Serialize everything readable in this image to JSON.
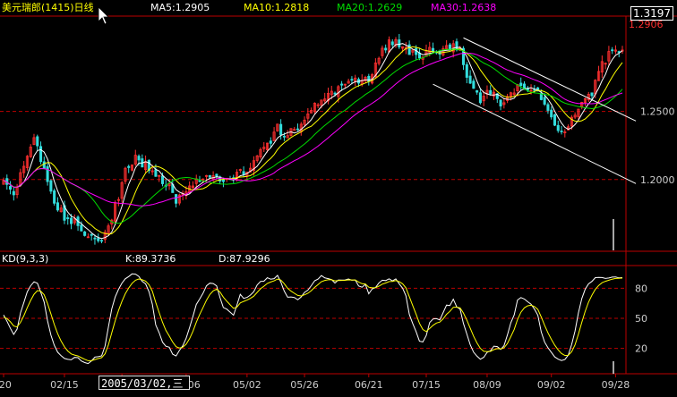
{
  "header": {
    "title": "美元瑞郎(1415)日线",
    "ma5": "MA5:1.2905",
    "ma10": "MA10:1.2818",
    "ma20": "MA20:1.2629",
    "ma30": "MA30:1.2638",
    "last_price": "1.3197",
    "price_tag": "1.2906"
  },
  "kd_header": {
    "label": "KD(9,3,3)",
    "k": "K:89.3736",
    "d": "D:87.9296"
  },
  "cursor_date": "2005/03/02,三",
  "colors": {
    "up": "#ff3030",
    "down": "#33dddd",
    "ma5": "#ffffff",
    "ma10": "#ffff00",
    "ma20": "#00dd00",
    "ma30": "#ff00ff",
    "grid": "#bb0000",
    "k": "#ffffff",
    "d": "#ffff00"
  },
  "chart_data": [
    {
      "type": "candlestick",
      "title": "美元瑞郎(1415)日线",
      "y_ticks": [
        "1.2000",
        "1.2500"
      ],
      "y_tick_values": [
        1.2,
        1.25
      ],
      "ylim": [
        1.148,
        1.32
      ],
      "x_tick_labels": [
        "/20",
        "02/15",
        "03/10",
        "04/06",
        "05/02",
        "05/26",
        "06/21",
        "07/15",
        "08/09",
        "09/02",
        "09/28"
      ],
      "x_tick_index": [
        0,
        18,
        35,
        54,
        72,
        89,
        108,
        125,
        143,
        162,
        181
      ],
      "anchors": [
        [
          0,
          1.196
        ],
        [
          3,
          1.19
        ],
        [
          6,
          1.21
        ],
        [
          9,
          1.228
        ],
        [
          12,
          1.21
        ],
        [
          15,
          1.185
        ],
        [
          18,
          1.172
        ],
        [
          21,
          1.168
        ],
        [
          24,
          1.16
        ],
        [
          27,
          1.155
        ],
        [
          30,
          1.158
        ],
        [
          33,
          1.18
        ],
        [
          36,
          1.205
        ],
        [
          39,
          1.215
        ],
        [
          42,
          1.21
        ],
        [
          45,
          1.205
        ],
        [
          48,
          1.198
        ],
        [
          51,
          1.185
        ],
        [
          54,
          1.19
        ],
        [
          57,
          1.202
        ],
        [
          60,
          1.2
        ],
        [
          63,
          1.2
        ],
        [
          66,
          1.198
        ],
        [
          69,
          1.205
        ],
        [
          72,
          1.208
        ],
        [
          75,
          1.218
        ],
        [
          78,
          1.225
        ],
        [
          81,
          1.238
        ],
        [
          84,
          1.233
        ],
        [
          87,
          1.24
        ],
        [
          90,
          1.25
        ],
        [
          93,
          1.258
        ],
        [
          96,
          1.262
        ],
        [
          99,
          1.265
        ],
        [
          102,
          1.27
        ],
        [
          105,
          1.272
        ],
        [
          108,
          1.275
        ],
        [
          111,
          1.29
        ],
        [
          114,
          1.302
        ],
        [
          117,
          1.3
        ],
        [
          120,
          1.295
        ],
        [
          123,
          1.29
        ],
        [
          126,
          1.298
        ],
        [
          129,
          1.292
        ],
        [
          132,
          1.298
        ],
        [
          135,
          1.295
        ],
        [
          138,
          1.27
        ],
        [
          141,
          1.258
        ],
        [
          144,
          1.265
        ],
        [
          147,
          1.255
        ],
        [
          150,
          1.262
        ],
        [
          153,
          1.27
        ],
        [
          156,
          1.268
        ],
        [
          159,
          1.262
        ],
        [
          162,
          1.245
        ],
        [
          165,
          1.232
        ],
        [
          168,
          1.245
        ],
        [
          171,
          1.258
        ],
        [
          174,
          1.265
        ],
        [
          177,
          1.285
        ],
        [
          180,
          1.294
        ],
        [
          182,
          1.296
        ]
      ],
      "channel_lines": [
        [
          [
            136,
            1.304
          ],
          [
            187,
            1.243
          ]
        ],
        [
          [
            127,
            1.27
          ],
          [
            187,
            1.197
          ]
        ]
      ]
    },
    {
      "type": "line",
      "title": "KD(9,3,3)",
      "y_ticks": [
        "20",
        "50",
        "80"
      ],
      "y_tick_values": [
        20,
        50,
        80
      ],
      "ylim": [
        0,
        100
      ],
      "series": [
        {
          "name": "K",
          "last": 89.3736
        },
        {
          "name": "D",
          "last": 87.9296
        }
      ]
    }
  ]
}
